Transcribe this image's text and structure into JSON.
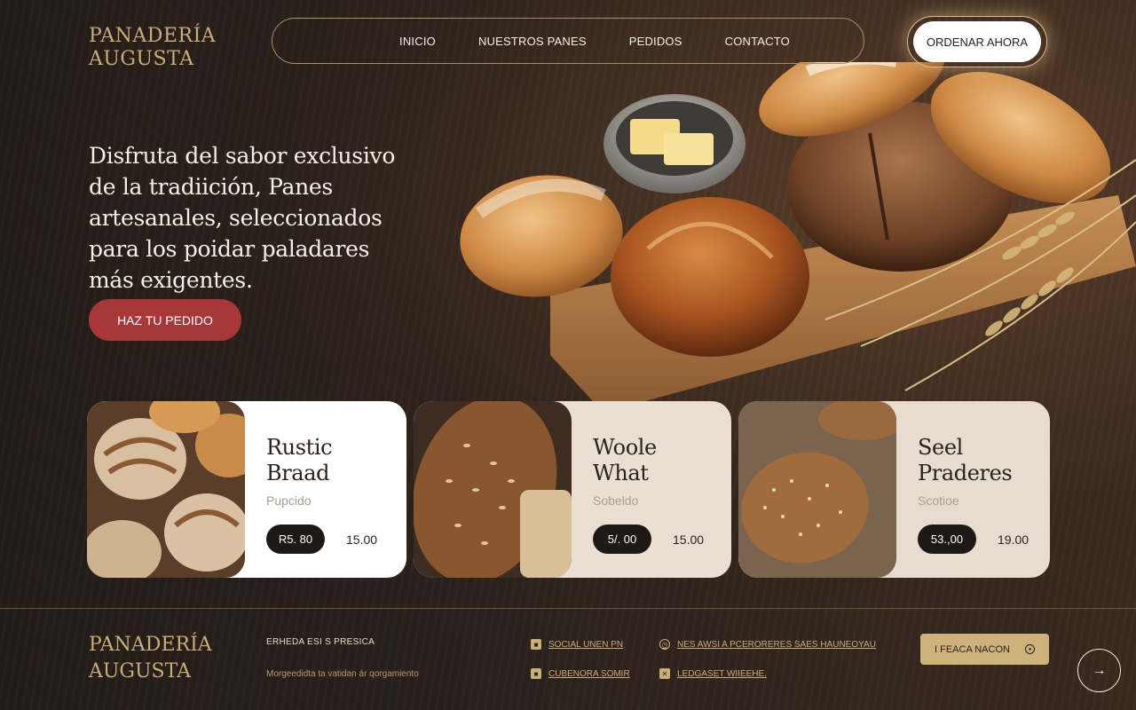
{
  "brand": {
    "line1": "PANADERÍA",
    "line2": "AUGUSTA"
  },
  "nav": {
    "items": [
      "INICIO",
      "NUESTROS PANES",
      "PEDIDOS",
      "CONTACTO"
    ],
    "order_label": "ORDENAR AHORA"
  },
  "hero": {
    "headline": "Disfruta del sabor exclusivo de la tradiición, Panes artesanales, seleccionados para los poidar paladares más exigentes.",
    "cta_label": "HAZ TU PEDIDO"
  },
  "products": [
    {
      "name_line1": "Rustic",
      "name_line2": "Braad",
      "subtitle": "Pupcido",
      "price": "R5. 80",
      "alt_price": "15.00"
    },
    {
      "name_line1": "Woole",
      "name_line2": "What",
      "subtitle": "Sobeldo",
      "price": "5/. 00",
      "alt_price": "15.00"
    },
    {
      "name_line1": "Seel",
      "name_line2": "Praderes",
      "subtitle": "Scotioe",
      "price": "53.,00",
      "alt_price": "19.00"
    }
  ],
  "footer": {
    "brand_line1": "PANADERÍA",
    "brand_line2": "AUGUSTA",
    "col1_title": "ERHEDA ESI S PRESICA",
    "col1_text": "Morgeedidta ta vatidan ár qorgamiento",
    "links": [
      {
        "icon": "square-icon",
        "label": "SOCIAL UNEN PN"
      },
      {
        "icon": "clock-icon",
        "label": "NES AWSI A PCERORERES SAES HAUNEOYAU"
      },
      {
        "icon": "square-icon",
        "label": "CUBENORA SOMIR"
      },
      {
        "icon": "x-icon",
        "label": "LEDGASET WIIEEHE."
      }
    ],
    "cta_label": "I FEACA NACON",
    "arrow": "→"
  },
  "colors": {
    "background": "#2a211c",
    "gold": "#c9ae76",
    "cta_red": "#a8373a",
    "cream_card": "#e9e0d3"
  }
}
